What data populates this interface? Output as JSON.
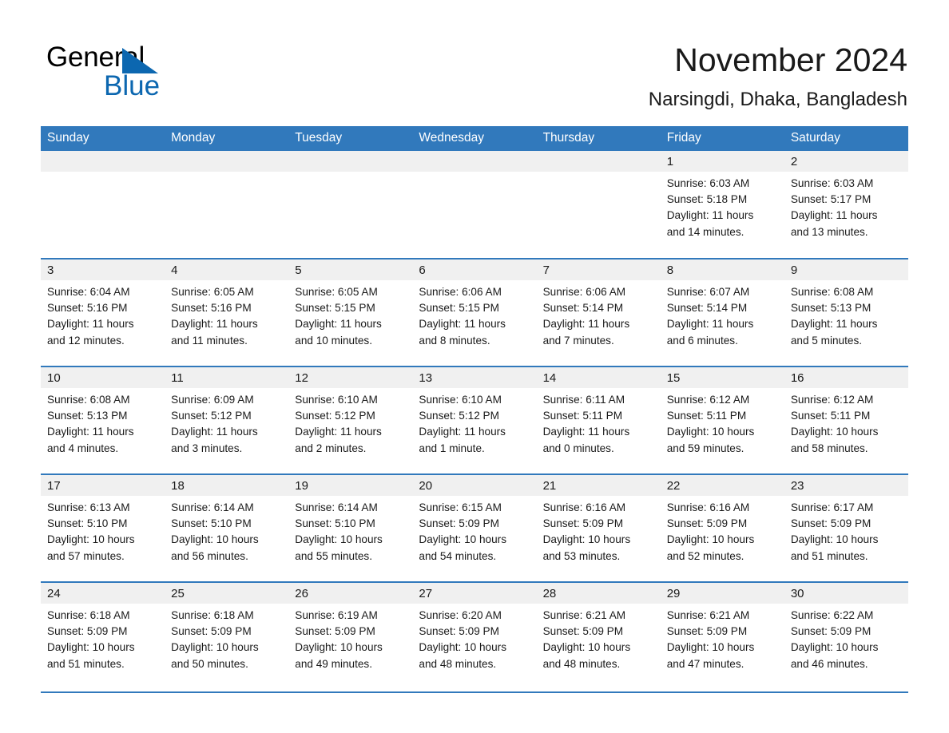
{
  "brand": {
    "name_part1": "General",
    "name_part2": "Blue",
    "triangle_color": "#0c67b0"
  },
  "header": {
    "month_title": "November 2024",
    "location": "Narsingdi, Dhaka, Bangladesh"
  },
  "theme": {
    "header_blue": "#3179bc",
    "band_grey": "#f0f0f0",
    "text": "#1a1a1a"
  },
  "weekday_headers": [
    "Sunday",
    "Monday",
    "Tuesday",
    "Wednesday",
    "Thursday",
    "Friday",
    "Saturday"
  ],
  "weeks": [
    [
      {
        "day": "",
        "sunrise": "",
        "sunset": "",
        "daylight_line1": "",
        "daylight_line2": ""
      },
      {
        "day": "",
        "sunrise": "",
        "sunset": "",
        "daylight_line1": "",
        "daylight_line2": ""
      },
      {
        "day": "",
        "sunrise": "",
        "sunset": "",
        "daylight_line1": "",
        "daylight_line2": ""
      },
      {
        "day": "",
        "sunrise": "",
        "sunset": "",
        "daylight_line1": "",
        "daylight_line2": ""
      },
      {
        "day": "",
        "sunrise": "",
        "sunset": "",
        "daylight_line1": "",
        "daylight_line2": ""
      },
      {
        "day": "1",
        "sunrise": "Sunrise: 6:03 AM",
        "sunset": "Sunset: 5:18 PM",
        "daylight_line1": "Daylight: 11 hours",
        "daylight_line2": "and 14 minutes."
      },
      {
        "day": "2",
        "sunrise": "Sunrise: 6:03 AM",
        "sunset": "Sunset: 5:17 PM",
        "daylight_line1": "Daylight: 11 hours",
        "daylight_line2": "and 13 minutes."
      }
    ],
    [
      {
        "day": "3",
        "sunrise": "Sunrise: 6:04 AM",
        "sunset": "Sunset: 5:16 PM",
        "daylight_line1": "Daylight: 11 hours",
        "daylight_line2": "and 12 minutes."
      },
      {
        "day": "4",
        "sunrise": "Sunrise: 6:05 AM",
        "sunset": "Sunset: 5:16 PM",
        "daylight_line1": "Daylight: 11 hours",
        "daylight_line2": "and 11 minutes."
      },
      {
        "day": "5",
        "sunrise": "Sunrise: 6:05 AM",
        "sunset": "Sunset: 5:15 PM",
        "daylight_line1": "Daylight: 11 hours",
        "daylight_line2": "and 10 minutes."
      },
      {
        "day": "6",
        "sunrise": "Sunrise: 6:06 AM",
        "sunset": "Sunset: 5:15 PM",
        "daylight_line1": "Daylight: 11 hours",
        "daylight_line2": "and 8 minutes."
      },
      {
        "day": "7",
        "sunrise": "Sunrise: 6:06 AM",
        "sunset": "Sunset: 5:14 PM",
        "daylight_line1": "Daylight: 11 hours",
        "daylight_line2": "and 7 minutes."
      },
      {
        "day": "8",
        "sunrise": "Sunrise: 6:07 AM",
        "sunset": "Sunset: 5:14 PM",
        "daylight_line1": "Daylight: 11 hours",
        "daylight_line2": "and 6 minutes."
      },
      {
        "day": "9",
        "sunrise": "Sunrise: 6:08 AM",
        "sunset": "Sunset: 5:13 PM",
        "daylight_line1": "Daylight: 11 hours",
        "daylight_line2": "and 5 minutes."
      }
    ],
    [
      {
        "day": "10",
        "sunrise": "Sunrise: 6:08 AM",
        "sunset": "Sunset: 5:13 PM",
        "daylight_line1": "Daylight: 11 hours",
        "daylight_line2": "and 4 minutes."
      },
      {
        "day": "11",
        "sunrise": "Sunrise: 6:09 AM",
        "sunset": "Sunset: 5:12 PM",
        "daylight_line1": "Daylight: 11 hours",
        "daylight_line2": "and 3 minutes."
      },
      {
        "day": "12",
        "sunrise": "Sunrise: 6:10 AM",
        "sunset": "Sunset: 5:12 PM",
        "daylight_line1": "Daylight: 11 hours",
        "daylight_line2": "and 2 minutes."
      },
      {
        "day": "13",
        "sunrise": "Sunrise: 6:10 AM",
        "sunset": "Sunset: 5:12 PM",
        "daylight_line1": "Daylight: 11 hours",
        "daylight_line2": "and 1 minute."
      },
      {
        "day": "14",
        "sunrise": "Sunrise: 6:11 AM",
        "sunset": "Sunset: 5:11 PM",
        "daylight_line1": "Daylight: 11 hours",
        "daylight_line2": "and 0 minutes."
      },
      {
        "day": "15",
        "sunrise": "Sunrise: 6:12 AM",
        "sunset": "Sunset: 5:11 PM",
        "daylight_line1": "Daylight: 10 hours",
        "daylight_line2": "and 59 minutes."
      },
      {
        "day": "16",
        "sunrise": "Sunrise: 6:12 AM",
        "sunset": "Sunset: 5:11 PM",
        "daylight_line1": "Daylight: 10 hours",
        "daylight_line2": "and 58 minutes."
      }
    ],
    [
      {
        "day": "17",
        "sunrise": "Sunrise: 6:13 AM",
        "sunset": "Sunset: 5:10 PM",
        "daylight_line1": "Daylight: 10 hours",
        "daylight_line2": "and 57 minutes."
      },
      {
        "day": "18",
        "sunrise": "Sunrise: 6:14 AM",
        "sunset": "Sunset: 5:10 PM",
        "daylight_line1": "Daylight: 10 hours",
        "daylight_line2": "and 56 minutes."
      },
      {
        "day": "19",
        "sunrise": "Sunrise: 6:14 AM",
        "sunset": "Sunset: 5:10 PM",
        "daylight_line1": "Daylight: 10 hours",
        "daylight_line2": "and 55 minutes."
      },
      {
        "day": "20",
        "sunrise": "Sunrise: 6:15 AM",
        "sunset": "Sunset: 5:09 PM",
        "daylight_line1": "Daylight: 10 hours",
        "daylight_line2": "and 54 minutes."
      },
      {
        "day": "21",
        "sunrise": "Sunrise: 6:16 AM",
        "sunset": "Sunset: 5:09 PM",
        "daylight_line1": "Daylight: 10 hours",
        "daylight_line2": "and 53 minutes."
      },
      {
        "day": "22",
        "sunrise": "Sunrise: 6:16 AM",
        "sunset": "Sunset: 5:09 PM",
        "daylight_line1": "Daylight: 10 hours",
        "daylight_line2": "and 52 minutes."
      },
      {
        "day": "23",
        "sunrise": "Sunrise: 6:17 AM",
        "sunset": "Sunset: 5:09 PM",
        "daylight_line1": "Daylight: 10 hours",
        "daylight_line2": "and 51 minutes."
      }
    ],
    [
      {
        "day": "24",
        "sunrise": "Sunrise: 6:18 AM",
        "sunset": "Sunset: 5:09 PM",
        "daylight_line1": "Daylight: 10 hours",
        "daylight_line2": "and 51 minutes."
      },
      {
        "day": "25",
        "sunrise": "Sunrise: 6:18 AM",
        "sunset": "Sunset: 5:09 PM",
        "daylight_line1": "Daylight: 10 hours",
        "daylight_line2": "and 50 minutes."
      },
      {
        "day": "26",
        "sunrise": "Sunrise: 6:19 AM",
        "sunset": "Sunset: 5:09 PM",
        "daylight_line1": "Daylight: 10 hours",
        "daylight_line2": "and 49 minutes."
      },
      {
        "day": "27",
        "sunrise": "Sunrise: 6:20 AM",
        "sunset": "Sunset: 5:09 PM",
        "daylight_line1": "Daylight: 10 hours",
        "daylight_line2": "and 48 minutes."
      },
      {
        "day": "28",
        "sunrise": "Sunrise: 6:21 AM",
        "sunset": "Sunset: 5:09 PM",
        "daylight_line1": "Daylight: 10 hours",
        "daylight_line2": "and 48 minutes."
      },
      {
        "day": "29",
        "sunrise": "Sunrise: 6:21 AM",
        "sunset": "Sunset: 5:09 PM",
        "daylight_line1": "Daylight: 10 hours",
        "daylight_line2": "and 47 minutes."
      },
      {
        "day": "30",
        "sunrise": "Sunrise: 6:22 AM",
        "sunset": "Sunset: 5:09 PM",
        "daylight_line1": "Daylight: 10 hours",
        "daylight_line2": "and 46 minutes."
      }
    ]
  ]
}
